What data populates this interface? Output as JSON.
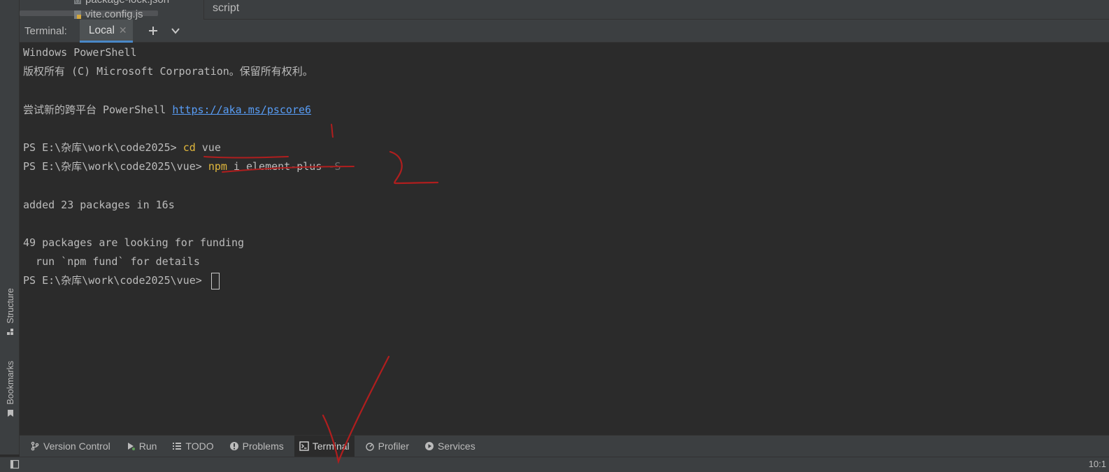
{
  "project_tree": {
    "files": [
      {
        "name": "package-lock.json",
        "icon": "json-file-icon"
      },
      {
        "name": "vite.config.js",
        "icon": "js-file-icon"
      }
    ]
  },
  "editor": {
    "breadcrumb": "script"
  },
  "terminal": {
    "title": "Terminal:",
    "tab_label": "Local",
    "lines": {
      "l1": "Windows PowerShell",
      "l2": "版权所有 (C) Microsoft Corporation。保留所有权利。",
      "l4_text": "尝试新的跨平台 PowerShell ",
      "l4_link": "https://aka.ms/pscore6",
      "l6_prompt": "PS E:\\杂库\\work\\code2025> ",
      "l6_cmd": "cd",
      "l6_args": " vue",
      "l7_prompt": "PS E:\\杂库\\work\\code2025\\vue> ",
      "l7_cmd": "npm",
      "l7_args": " i element-plus ",
      "l7_param": "-S",
      "l9": "added 23 packages in 16s",
      "l11": "49 packages are looking for funding",
      "l12": "  run `npm fund` for details",
      "l13_prompt": "PS E:\\杂库\\work\\code2025\\vue> "
    }
  },
  "side_tabs": {
    "structure": "Structure",
    "bookmarks": "Bookmarks"
  },
  "tool_windows": [
    {
      "label": "Version Control",
      "icon": "git-branch-icon"
    },
    {
      "label": "Run",
      "icon": "run-icon"
    },
    {
      "label": "TODO",
      "icon": "todo-list-icon"
    },
    {
      "label": "Problems",
      "icon": "problems-icon"
    },
    {
      "label": "Terminal",
      "icon": "terminal-icon",
      "active": true
    },
    {
      "label": "Profiler",
      "icon": "profiler-icon"
    },
    {
      "label": "Services",
      "icon": "services-icon"
    }
  ],
  "status": {
    "time": "10:1"
  },
  "colors": {
    "background": "#2b2b2b",
    "panel": "#3c3f41",
    "command": "#e0b73c",
    "link": "#589df6",
    "accent": "#4a88c7",
    "annotation": "#b01e1e"
  }
}
